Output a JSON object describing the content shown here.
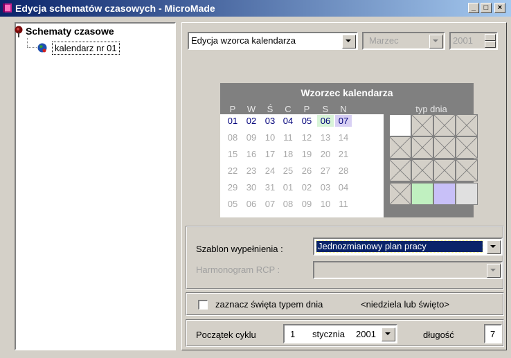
{
  "window": {
    "title": "Edycja schematów czasowych - MicroMade",
    "minimize_glyph": "_",
    "maximize_glyph": "□",
    "close_glyph": "×"
  },
  "tree": {
    "root_label": "Schematy czasowe",
    "root_icon": "pin-icon",
    "child_label": "kalendarz nr 01",
    "child_icon": "globe-icon"
  },
  "top_controls": {
    "mode_value": "Edycja wzorca kalendarza",
    "month_value": "Marzec",
    "year_value": "2001"
  },
  "calendar": {
    "title": "Wzorzec kalendarza",
    "day_headers": [
      "P",
      "W",
      "Ś",
      "C",
      "P",
      "S",
      "N"
    ],
    "typ_dnia_label": "typ dnia",
    "weeks": [
      [
        "01",
        "02",
        "03",
        "04",
        "05",
        "06",
        "07"
      ],
      [
        "08",
        "09",
        "10",
        "11",
        "12",
        "13",
        "14"
      ],
      [
        "15",
        "16",
        "17",
        "18",
        "19",
        "20",
        "21"
      ],
      [
        "22",
        "23",
        "24",
        "25",
        "26",
        "27",
        "28"
      ],
      [
        "29",
        "30",
        "31",
        "01",
        "02",
        "03",
        "04"
      ],
      [
        "05",
        "06",
        "07",
        "08",
        "09",
        "10",
        "11"
      ]
    ],
    "highlight_colors": {
      "saturday": "#d8f4d8",
      "sunday": "#d8d0f4"
    },
    "typ_dnia_swatches": [
      "#ffffff",
      "#c0f0c0",
      "#c8c0f8",
      "#e0e0e0"
    ]
  },
  "settings": {
    "szablon_label": "Szablon wypełnienia :",
    "szablon_value": "Jednozmianowy plan pracy",
    "harmonogram_label": "Harmonogram RCP :",
    "harmonogram_value": "",
    "checkbox_label": "zaznacz święta typem dnia",
    "checkbox_hint": "<niedziela lub święto>",
    "poczatek_label": "Początek cyklu",
    "poczatek_day": "1",
    "poczatek_month": "stycznia",
    "poczatek_year": "2001",
    "dlugosc_label": "długość",
    "dlugosc_value": "7"
  }
}
